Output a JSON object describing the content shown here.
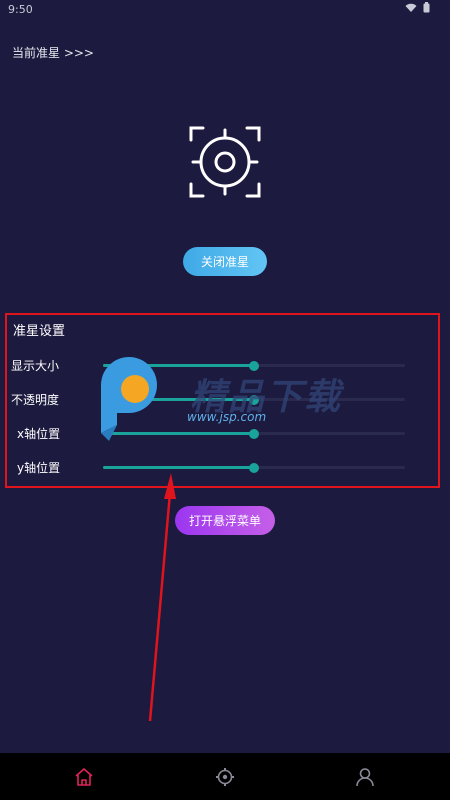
{
  "status_bar": {
    "time": "9:50"
  },
  "header": {
    "current_crosshair_label": "当前准星 >>>"
  },
  "crosshair": {
    "icon": "crosshair-icon",
    "color": "#ffffff"
  },
  "toggle_button": {
    "label": "关闭准星",
    "color": "#4fb6ec"
  },
  "settings": {
    "title": "准星设置",
    "border_color": "#e0141c",
    "accent_color": "#1aa39a",
    "items": [
      {
        "label": "显示大小",
        "value": 0.5
      },
      {
        "label": "不透明度",
        "value": 0.5
      },
      {
        "label": "x轴位置",
        "value": 0.5
      },
      {
        "label": "y轴位置",
        "value": 0.5
      }
    ]
  },
  "open_menu_button": {
    "label": "打开悬浮菜单",
    "color": "#b04aec"
  },
  "watermark": {
    "text": "精品下载",
    "url": "www.jsp.com"
  },
  "bottom_nav": {
    "items": [
      {
        "icon": "home-icon",
        "active": true
      },
      {
        "icon": "crosshair-settings-icon",
        "active": false
      },
      {
        "icon": "user-icon",
        "active": false
      }
    ]
  }
}
